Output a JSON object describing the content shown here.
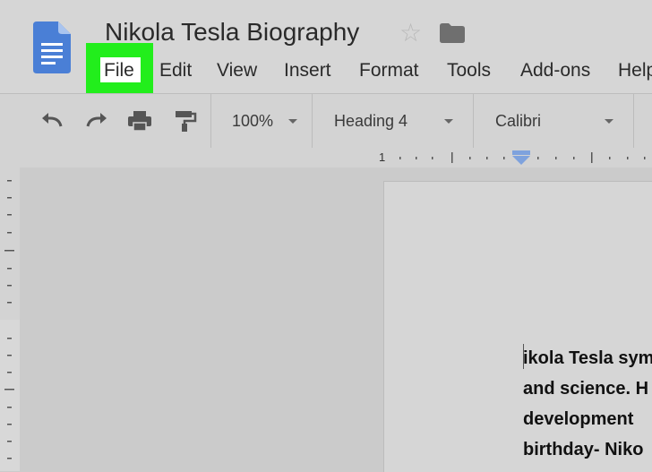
{
  "document": {
    "title": "Nikola Tesla Biography"
  },
  "menu": {
    "items": [
      {
        "label": "File",
        "highlighted": true
      },
      {
        "label": "Edit"
      },
      {
        "label": "View"
      },
      {
        "label": "Insert"
      },
      {
        "label": "Format"
      },
      {
        "label": "Tools"
      },
      {
        "label": "Add-ons"
      },
      {
        "label": "Help"
      }
    ]
  },
  "toolbar": {
    "icons": [
      "undo-icon",
      "redo-icon",
      "print-icon",
      "paint-format-icon"
    ],
    "zoom": "100%",
    "style": "Heading 4",
    "font": "Calibri"
  },
  "ruler": {
    "marker": "1"
  },
  "body_text": {
    "lines": [
      "ikola Tesla sym",
      "and science. H",
      "development",
      "birthday- Niko"
    ]
  },
  "colors": {
    "highlight": "#22ee1c",
    "docs_blue": "#4a7fd6"
  }
}
